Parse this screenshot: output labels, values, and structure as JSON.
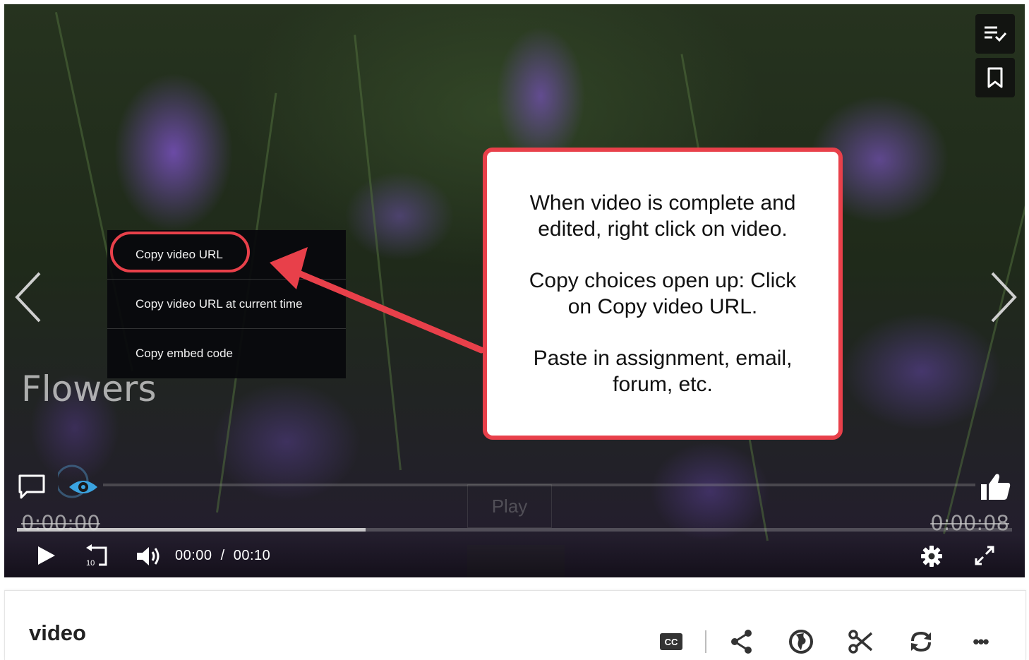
{
  "player": {
    "overlay_title": "Flowers",
    "context_menu": {
      "items": [
        {
          "label": "Copy video URL",
          "highlighted": true
        },
        {
          "label": "Copy video URL at current time",
          "highlighted": false
        },
        {
          "label": "Copy embed code",
          "highlighted": false
        }
      ]
    },
    "callout": {
      "paragraphs": [
        "When video is complete and edited, right click on video.",
        "Copy choices open up: Click on Copy video URL.",
        "Paste in assignment, email, forum, etc."
      ],
      "accent_color": "#e8404a"
    },
    "ghost_play_label": "Play",
    "overlay_time_start": "0:00:00",
    "overlay_time_end": "0:00:08",
    "progress_fraction": 0.35,
    "controls": {
      "current_time": "00:00",
      "separator": "/",
      "duration": "00:10",
      "rewind_seconds": "10"
    },
    "icons": [
      "playlist-check-icon",
      "bookmark-icon",
      "chevron-left-icon",
      "chevron-right-icon",
      "speech-bubble-icon",
      "eye-icon",
      "thumbs-up-icon",
      "play-icon",
      "rewind-10-icon",
      "volume-icon",
      "gear-icon",
      "expand-icon"
    ]
  },
  "info_bar": {
    "title": "video",
    "tools": [
      "closed-captions-icon",
      "share-icon",
      "globe-icon",
      "scissors-icon",
      "refresh-icon",
      "more-icon"
    ],
    "cc_label": "CC",
    "more_label": "•••"
  }
}
